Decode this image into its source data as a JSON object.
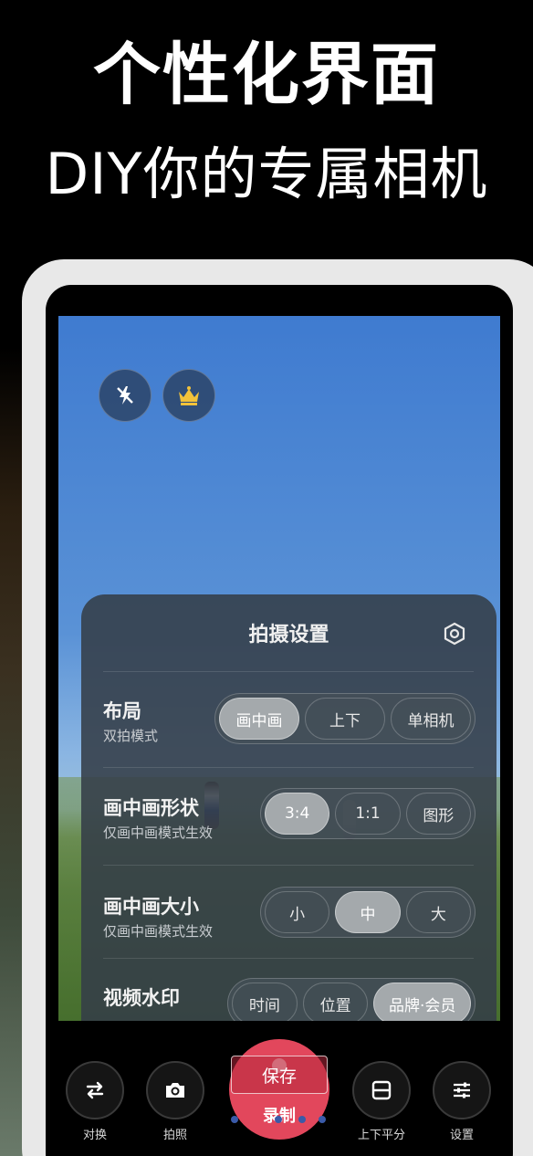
{
  "promo": {
    "headline": "个性化界面",
    "subhead": "DIY你的专属相机"
  },
  "camera_top": {
    "flash_icon": "flash-off-icon",
    "crown_icon": "crown-icon"
  },
  "settings_panel": {
    "title": "拍摄设置",
    "settings_icon": "hexagon-gear-icon",
    "rows": [
      {
        "label": "布局",
        "sublabel": "双拍模式",
        "options": [
          "画中画",
          "上下",
          "单相机"
        ],
        "selected": "画中画"
      },
      {
        "label": "画中画形状",
        "sublabel": "仅画中画模式生效",
        "options": [
          "3:4",
          "1:1",
          "图形"
        ],
        "selected": "3:4"
      },
      {
        "label": "画中画大小",
        "sublabel": "仅画中画模式生效",
        "options": [
          "小",
          "中",
          "大"
        ],
        "selected": "中"
      },
      {
        "label": "视频水印",
        "sublabel": "",
        "options": [
          "时间",
          "位置",
          "品牌·会员"
        ],
        "selected": "品牌·会员"
      }
    ]
  },
  "bottom_bar": {
    "switch_label": "对换",
    "photo_label": "拍照",
    "record_label": "录制",
    "save_tip": "保存",
    "split_label": "上下平分",
    "settings_label": "设置"
  },
  "colors": {
    "record_red": "#e2475c",
    "panel_bg": "#343e48",
    "selected_option": "#a4a9ac"
  }
}
